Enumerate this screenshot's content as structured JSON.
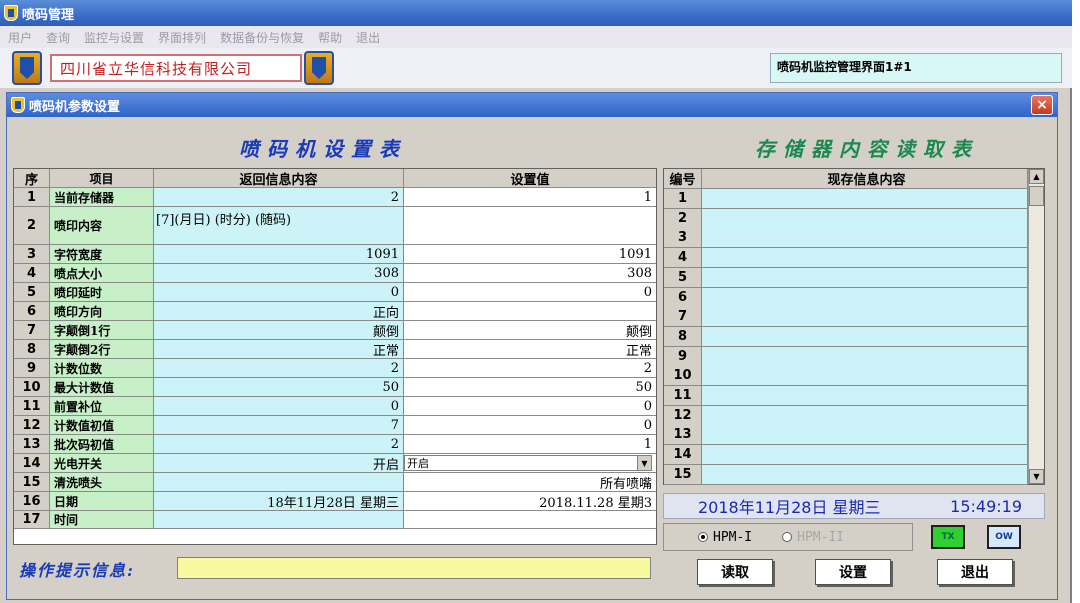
{
  "app": {
    "title": "喷码管理",
    "menu": [
      "用户",
      "查询",
      "监控与设置",
      "界面排列",
      "数据备份与恢复",
      "帮助",
      "退出"
    ],
    "company": "四川省立华信科技有限公司",
    "monitor_title": "喷码机监控管理界面1#1"
  },
  "dialog": {
    "title": "喷码机参数设置",
    "close": "×",
    "left_title": "喷码机设置表",
    "right_title": "存储器内容读取表",
    "left_headers": [
      "序",
      "项目",
      "返回信息内容",
      "设置值"
    ],
    "rows": [
      {
        "no": "1",
        "item": "当前存储器",
        "ret": "2",
        "set": "1"
      },
      {
        "no": "2",
        "item": "喷印内容",
        "ret": "[7](月日) (时分) (随码)",
        "set": ""
      },
      {
        "no": "3",
        "item": "字符宽度",
        "ret": "1091",
        "set": "1091"
      },
      {
        "no": "4",
        "item": "喷点大小",
        "ret": "308",
        "set": "308"
      },
      {
        "no": "5",
        "item": "喷印延时",
        "ret": "0",
        "set": "0"
      },
      {
        "no": "6",
        "item": "喷印方向",
        "ret": "正向",
        "set": ""
      },
      {
        "no": "7",
        "item": "字颠倒1行",
        "ret": "颠倒",
        "set": "颠倒"
      },
      {
        "no": "8",
        "item": "字颠倒2行",
        "ret": "正常",
        "set": "正常"
      },
      {
        "no": "9",
        "item": "计数位数",
        "ret": "2",
        "set": "2"
      },
      {
        "no": "10",
        "item": "最大计数值",
        "ret": "50",
        "set": "50"
      },
      {
        "no": "11",
        "item": "前置补位",
        "ret": "0",
        "set": "0"
      },
      {
        "no": "12",
        "item": "计数值初值",
        "ret": "7",
        "set": "0"
      },
      {
        "no": "13",
        "item": "批次码初值",
        "ret": "2",
        "set": "1"
      },
      {
        "no": "14",
        "item": "光电开关",
        "ret": "开启",
        "set": "开启"
      },
      {
        "no": "15",
        "item": "清洗喷头",
        "ret": "",
        "set": "所有喷嘴"
      },
      {
        "no": "16",
        "item": "日期",
        "ret": "18年11月28日 星期三",
        "set": "2018.11.28 星期3"
      },
      {
        "no": "17",
        "item": "时间",
        "ret": "",
        "set": ""
      }
    ],
    "right_headers": [
      "编号",
      "现存信息内容"
    ],
    "right_rows": [
      "1",
      "2",
      "3",
      "4",
      "5",
      "6",
      "7",
      "8",
      "9",
      "10",
      "11",
      "12",
      "13",
      "14",
      "15"
    ],
    "date_text": "2018年11月28日 星期三",
    "time_text": "15:49:19",
    "radio_1": "HPM-I",
    "radio_2": "HPM-II",
    "indicator_tx": "TX",
    "indicator_ow": "OW",
    "btn_read": "读取",
    "btn_set": "设置",
    "btn_exit": "退出",
    "hint_label": "操作提示信息:",
    "hint_value": ""
  },
  "colors": {
    "titlebar": "#3a6cc8",
    "item_bg": "#c8f0c8",
    "return_bg": "#ccf4f8",
    "hint_bg": "#f8f8a0",
    "left_title": "#1a3ab8",
    "right_title": "#1a8a50"
  }
}
